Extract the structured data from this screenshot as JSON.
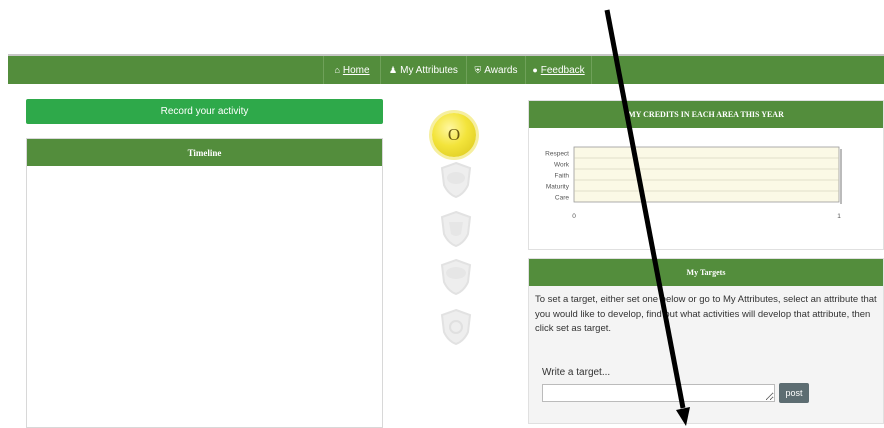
{
  "nav": {
    "home": "Home",
    "attributes": "My Attributes",
    "awards": "Awards",
    "feedback": "Feedback",
    "icons": [
      "home-icon",
      "user-icon",
      "shield-icon",
      "comment-icon"
    ]
  },
  "record_button": "Record your activity",
  "timeline": {
    "title": "Timeline"
  },
  "badges": {
    "gold_label": "O"
  },
  "credits": {
    "title": "MY CREDITS IN EACH AREA THIS YEAR",
    "chart_data": {
      "type": "bar",
      "orientation": "horizontal",
      "categories": [
        "Respect",
        "Work",
        "Faith",
        "Maturity",
        "Care"
      ],
      "values": [
        0,
        0,
        0,
        0,
        0
      ],
      "xlim": [
        0,
        1
      ],
      "xticks": [
        "0",
        "1"
      ],
      "grid": true,
      "title": "",
      "xlabel": "",
      "ylabel": ""
    }
  },
  "targets": {
    "title": "My Targets",
    "description": "To set a target, either set one below or go to My Attributes, select an attribute that you would like to develop, find out what activities will develop that attribute, then click set as target.",
    "label": "Write a target...",
    "input_value": "",
    "post_label": "post"
  },
  "colors": {
    "nav": "#538d3c",
    "record": "#2ea94a",
    "gold": "#f3e43b"
  }
}
